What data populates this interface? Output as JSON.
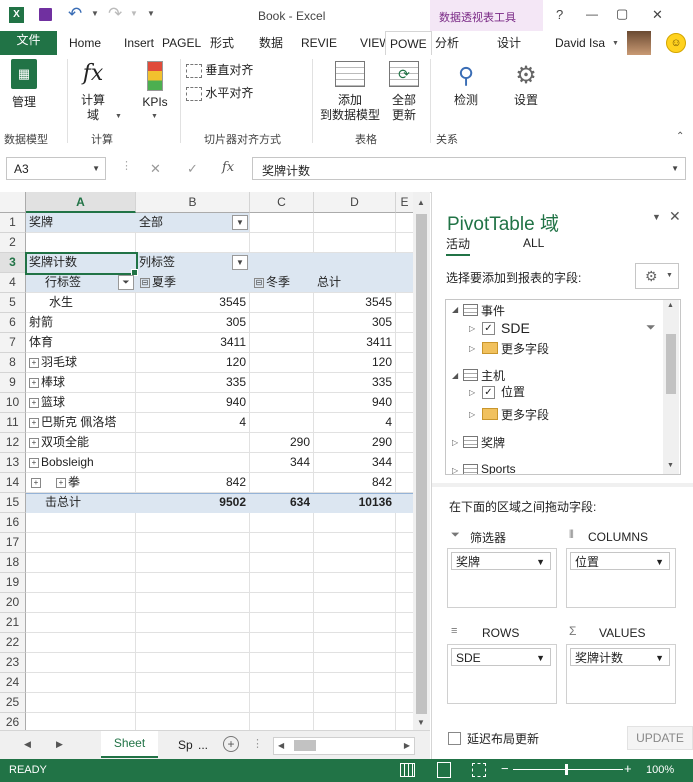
{
  "title_bar": {
    "title": "Book - Excel",
    "context_tools": "数据透视表工具",
    "help": "?",
    "minimize": "—",
    "restore": "▢",
    "close": "✕"
  },
  "tabs": {
    "file": "文件",
    "items": [
      "Home",
      "Insert",
      "PAGEL",
      "形式",
      "数据",
      "REVIE",
      "VIEW",
      "POWE",
      "分析",
      "设计"
    ],
    "user": "David Isa"
  },
  "ribbon": {
    "manage": "管理",
    "calc_field": "计算\n域",
    "kpis": "KPIs",
    "vertical_align": "垂直对齐",
    "horizontal_align": "水平对齐",
    "add_to_model": "添加\n到数据模型",
    "update_all": "全部\n更新",
    "detect": "检测",
    "settings": "设置",
    "groups": {
      "data_model": "数据模型",
      "calc": "计算",
      "slicer_align": "切片器对齐方式",
      "table": "表格",
      "relationships": "关系"
    }
  },
  "formula_bar": {
    "name_box": "A3",
    "cancel": "✕",
    "enter": "✓",
    "fx": "fx",
    "content": "奖牌计数"
  },
  "grid": {
    "columns": [
      "A",
      "B",
      "C",
      "D",
      "E"
    ],
    "rows": [
      "1",
      "2",
      "3",
      "4",
      "5",
      "6",
      "7",
      "8",
      "9",
      "10",
      "11",
      "12",
      "13",
      "14",
      "15",
      "16",
      "17",
      "18",
      "19",
      "20",
      "21",
      "22",
      "23",
      "24",
      "25",
      "26"
    ],
    "r1": {
      "a": "奖牌",
      "b": "全部"
    },
    "r3": {
      "a": "奖牌计数",
      "b": "列标签"
    },
    "r4": {
      "a": "行标签",
      "b": "夏季",
      "c": "冬季",
      "d": "总计"
    },
    "data": [
      {
        "label": "水生",
        "b": "3545",
        "c": "",
        "d": "3545"
      },
      {
        "label": "射箭",
        "b": "305",
        "c": "",
        "d": "305"
      },
      {
        "label": "体育",
        "b": "3411",
        "c": "",
        "d": "3411"
      },
      {
        "label": "羽毛球",
        "b": "120",
        "c": "",
        "d": "120"
      },
      {
        "label": "棒球",
        "b": "335",
        "c": "",
        "d": "335"
      },
      {
        "label": "篮球",
        "b": "940",
        "c": "",
        "d": "940"
      },
      {
        "label": "巴斯克 佩洛塔",
        "b": "4",
        "c": "",
        "d": "4"
      },
      {
        "label": "双项全能",
        "b": "",
        "c": "290",
        "d": "290"
      },
      {
        "label": "Bobsleigh",
        "b": "",
        "c": "344",
        "d": "344"
      },
      {
        "label": "拳",
        "b": "842",
        "c": "",
        "d": "842"
      }
    ],
    "total": {
      "label": "击总计",
      "b": "9502",
      "c": "634",
      "d": "10136"
    }
  },
  "sheet_tabs": {
    "active": "Sheet",
    "other": "Sp",
    "more": "..."
  },
  "status": {
    "ready": "READY",
    "zoom": "100%"
  },
  "pane": {
    "title": "PivotTable 域",
    "tab_active": "活动",
    "tab_all": "ALL",
    "choose_fields": "选择要添加到报表的字段:",
    "tree": {
      "events": "事件",
      "sde": "SDE",
      "more_fields_1": "更多字段",
      "hosts": "主机",
      "position": "位置",
      "more_fields_2": "更多字段",
      "medals": "奖牌",
      "sports": "Sports"
    },
    "drag_label": "在下面的区域之间拖动字段:",
    "filters_label": "筛选器",
    "columns_label": "COLUMNS",
    "rows_label": "ROWS",
    "values_label": "VALUES",
    "filters_item": "奖牌",
    "columns_item": "位置",
    "rows_item": "SDE",
    "values_item": "奖牌计数",
    "defer_label": "延迟布局更新",
    "update_button": "UPDATE"
  },
  "colors": {
    "excel_green": "#217346",
    "pivot_header_blue": "#dce6f1",
    "tools_pink": "#f4e7f6"
  }
}
